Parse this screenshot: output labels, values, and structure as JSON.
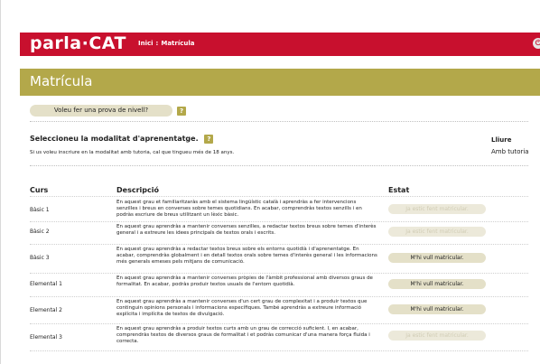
{
  "header": {
    "logo": "parla·CAT",
    "breadcrumb": [
      "Inici",
      "Matrícula"
    ],
    "breadcrumb_sep": ":",
    "power_icon": "power-icon"
  },
  "page": {
    "title": "Matrícula"
  },
  "level_test": {
    "label": "Voleu fer una prova de nivell?",
    "help": "?"
  },
  "modality": {
    "title": "Seleccioneu la modalitat d'aprenentatge.",
    "help": "?",
    "note": "Si us voleu inscriure en la modalitat amb tutoria, cal que tingueu més de 18 anys.",
    "column_title": "Lliure",
    "option": "Amb tutoria"
  },
  "table": {
    "headers": {
      "course": "Curs",
      "description": "Descripció",
      "status": "Estat"
    },
    "rows": [
      {
        "course": "Bàsic 1",
        "description": "En aquest grau et familiaritzaràs amb el sistema lingüístic català i aprendràs a fer intervencions senzilles i breus en converses sobre temes quotidians. En acabar, comprendràs textos senzills i en podràs escriure de breus utilitzant un lèxic bàsic.",
        "button": "Ja estic fent matricular.",
        "enabled": false
      },
      {
        "course": "Bàsic 2",
        "description": "En aquest grau aprendràs a mantenir converses senzilles, a redactar textos breus sobre temes d'interès general i a extreure les idees principals de textos orals i escrits.",
        "button": "Ja estic fent matricular.",
        "enabled": false
      },
      {
        "course": "Bàsic 3",
        "description": "En aquest grau aprendràs a redactar textos breus sobre els entorns quotidià i d'aprenentatge. En acabar, comprendràs globalment i en detall textos orals sobre temes d'interès general i les informacions més generals emeses pels mitjans de comunicació.",
        "button": "M'hi vull matricular.",
        "enabled": true
      },
      {
        "course": "Elemental 1",
        "description": "En aquest grau aprendràs a mantenir converses pròpies de l'àmbit professional amb diversos graus de formalitat. En acabar, podràs produir textos usuals de l'entorn quotidià.",
        "button": "M'hi vull matricular.",
        "enabled": true
      },
      {
        "course": "Elemental 2",
        "description": "En aquest grau aprendràs a mantenir converses d'un cert grau de complexitat i a produir textos que continguin opinions personals i informacions específiques. També aprendràs a extreure informació explícita i implícita de textos de divulgació.",
        "button": "M'hi vull matricular.",
        "enabled": true
      },
      {
        "course": "Elemental 3",
        "description": "En aquest grau aprendràs a produir textos curts amb un grau de correcció suficient. I, en acabar, comprendràs textos de diversos graus de formalitat i et podràs comunicar d'una manera força fluida i correcta.",
        "button": "Ja estic fent matricular.",
        "enabled": false
      }
    ]
  },
  "colors": {
    "brand": "#c8102e",
    "title_bar": "#b3a84a",
    "button_bg": "#e4e0c8"
  }
}
